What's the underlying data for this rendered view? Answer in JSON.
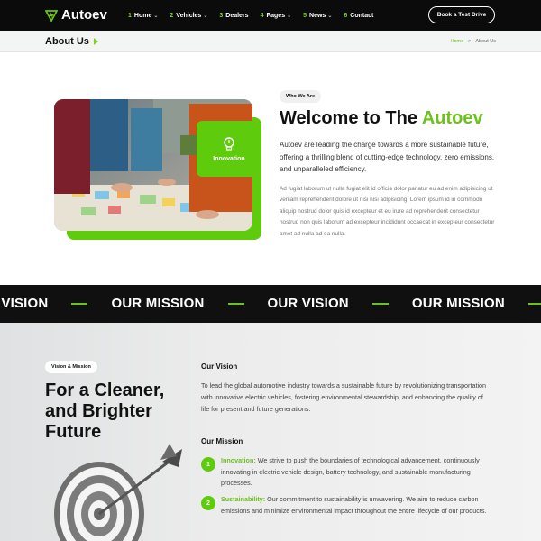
{
  "nav": {
    "logo_text": "Autoev",
    "items": [
      {
        "num": "1",
        "label": "Home",
        "chevron": true
      },
      {
        "num": "2",
        "label": "Vehicles",
        "chevron": true
      },
      {
        "num": "3",
        "label": "Dealers",
        "chevron": false
      },
      {
        "num": "4",
        "label": "Pages",
        "chevron": true
      },
      {
        "num": "5",
        "label": "News",
        "chevron": true
      },
      {
        "num": "6",
        "label": "Contact",
        "chevron": false
      }
    ],
    "cta_label": "Book a Test Drive"
  },
  "titlebar": {
    "title": "About Us",
    "breadcrumb": [
      "Home",
      ">",
      "About Us"
    ]
  },
  "about": {
    "badge_label": "Innovation",
    "tag": "Who We Are",
    "heading_prefix": "Welcome to The ",
    "heading_brand": "Autoev",
    "lead": "Autoev are leading the charge towards a more sustainable future, offering a thrilling blend of cutting-edge technology, zero emissions, and unparalleled efficiency.",
    "body": "Ad fugiat laborum ut nulla fugiat elit id officia dolor pariatur eu ad enim adipisicing ut veniam reprehenderit dolore ut nisi nisi adipisicing. Lorem ipsum id in commodo aliquip nostrud dolor quis id excepteur et eu irure ad reprehenderit consectetur nostrud non quis laborum ad excepteur incididunt occaecat in excepteur consectetur amet ad nulla ad ea nulla."
  },
  "marquee": {
    "words": [
      "R VISION",
      "OUR MISSION",
      "OUR VISION",
      "OUR MISSION",
      "OUR VISION"
    ]
  },
  "vision": {
    "tag": "Vision & Mission",
    "heading": "For a Cleaner, and Brighter Future",
    "vision_title": "Our Vision",
    "vision_text": "To lead the global automotive industry towards a sustainable future by revolutionizing transportation with innovative electric vehicles, fostering environmental stewardship, and enhancing the quality of life for present and future generations.",
    "mission_title": "Our Mission",
    "missions": [
      {
        "num": "1",
        "key": "Innovation:",
        "text": " We strive to push the boundaries of technological advancement, continuously innovating in electric vehicle design, battery technology, and sustainable manufacturing processes."
      },
      {
        "num": "2",
        "key": "Sustainability:",
        "text": " Our commitment to sustainability is unwavering. We aim to reduce carbon emissions and minimize environmental impact throughout the entire lifecycle of our products."
      }
    ]
  },
  "colors": {
    "accent": "#6cc11a",
    "nav_bg": "#0b0b0b"
  }
}
